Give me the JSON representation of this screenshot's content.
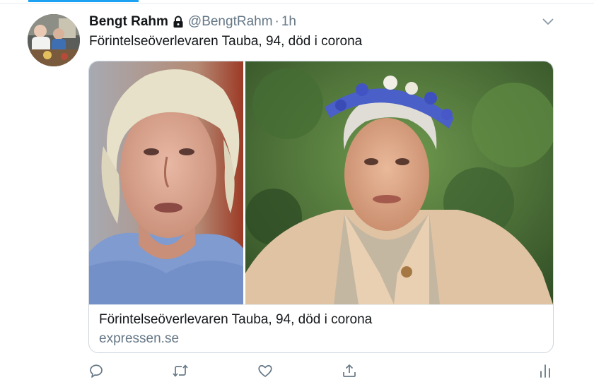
{
  "tweet": {
    "display_name": "Bengt Rahm",
    "handle": "@BengtRahm",
    "separator": "·",
    "time": "1h",
    "text": "Förintelseöverlevaren Tauba, 94, död i corona"
  },
  "card": {
    "title": "Förintelseöverlevaren Tauba, 94, död i corona",
    "domain": "expressen.se"
  },
  "icons": {
    "lock": "lock-icon",
    "more": "chevron-down-icon",
    "reply": "reply-icon",
    "retweet": "retweet-icon",
    "like": "heart-icon",
    "share": "share-icon",
    "analytics": "analytics-icon"
  },
  "colors": {
    "accent": "#1da1f2",
    "text": "#14171a",
    "secondary": "#657786",
    "border": "#ccd6dd"
  }
}
